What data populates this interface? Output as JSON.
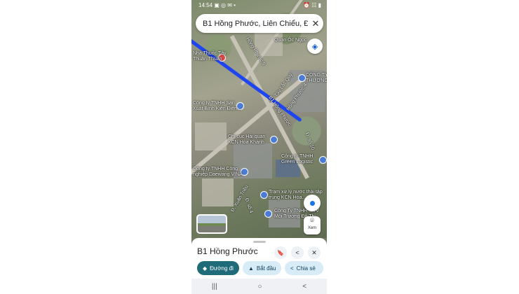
{
  "status_bar": {
    "time": "14:54",
    "icons": "▣ ◎ ✉ •",
    "right_icons": "⏰ ☷ ▮"
  },
  "search": {
    "value": "B1 Hồng Phước, Liên Chiểu, Đ..."
  },
  "map_labels": {
    "thuoc_tay": "Nhà Thuốc Tây\nThuận Thuần",
    "quan_ngoc": "Quán Ốc Ngọc",
    "road_hong_phuoc_5": "Hồng Phước 5",
    "cong_ty_thuong": "CÔNG TY\nTHƯƠNG...",
    "tay_lac_quy": "Tây Lắc Quý",
    "road_hong_phuoc_4": "Hồng Phước 4",
    "cong_ty_tnhh_san": "Công ty TNHH Sản\nXuất Bình Kiên Điện...",
    "road_b1": "B1 Hồng Phước",
    "road_so_10": "Đ. số 10",
    "chi_cuc": "Chi cục Hải quan\nKCN Hòa Khánh",
    "green_logistic": "Công ty TNHH\nGreen Logistic",
    "daewang": "Công ty TNHH Công\nnghiệp Daewang VINA",
    "tram_xu_ly": "Trạm xử lý nước thải tập\ntrung KCN Hòa...",
    "cong_ty_moi_truong": "Công Ty TNHH MTV\nMôi Trường Đô Thị...",
    "road_duong_so_4": "Đ. số 4",
    "road_xuan_trieu": "Đ. Xuân Triều"
  },
  "controls": {
    "xem_label": "Xem"
  },
  "place": {
    "name": "B1 Hồng Phước",
    "actions": {
      "save": "🔖",
      "share": "<",
      "close": "✕"
    }
  },
  "chips": [
    {
      "icon": "◆",
      "label": "Đường đi"
    },
    {
      "icon": "▲",
      "label": "Bắt đầu"
    },
    {
      "icon": "<",
      "label": "Chia sẻ"
    }
  ],
  "nav": {
    "recents": "|||",
    "home": "○",
    "back": "<"
  },
  "colors": {
    "route": "#1f45f0",
    "primary_chip": "#1f6b7a",
    "secondary_chip": "#d7ecf7",
    "pin_blue": "#4a7cd6",
    "pin_red": "#e34949"
  }
}
